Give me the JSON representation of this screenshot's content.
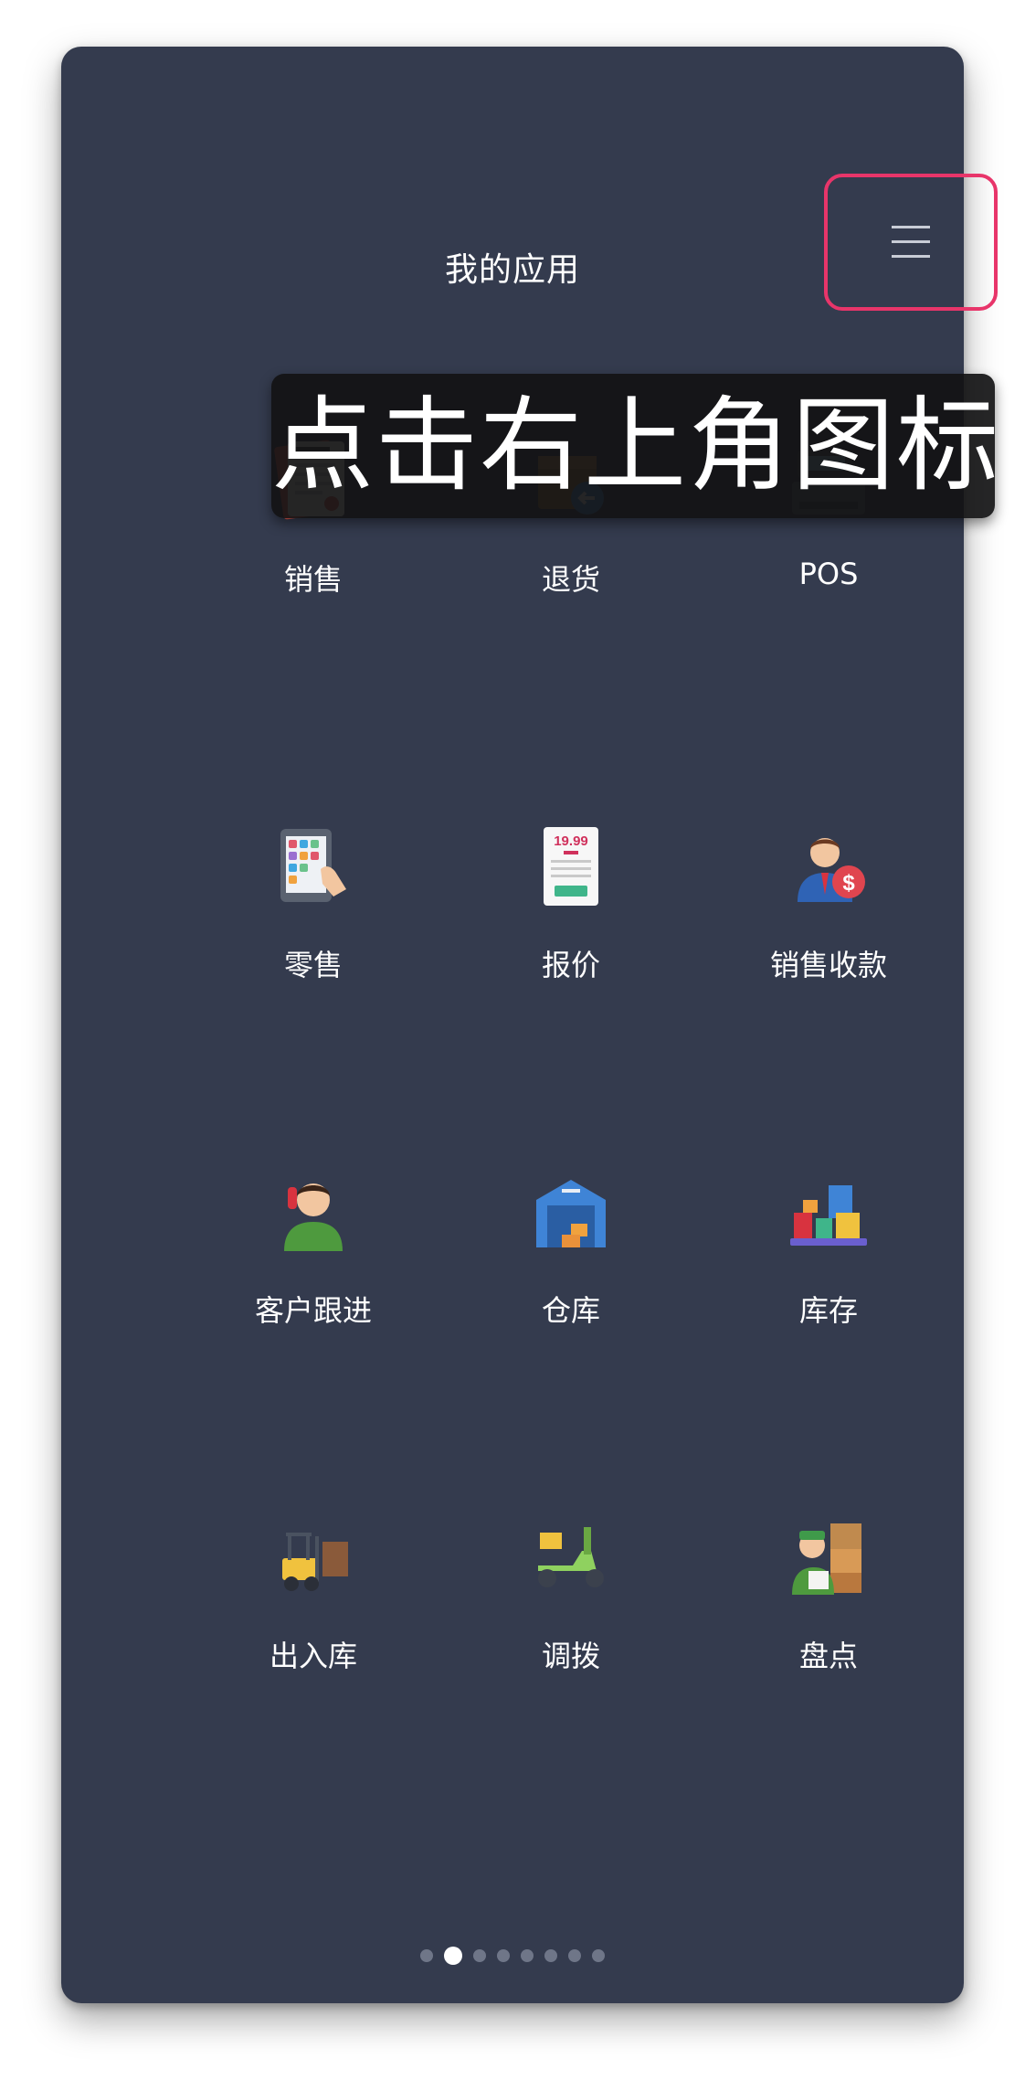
{
  "header": {
    "title": "我的应用"
  },
  "menu": {
    "icon": "hamburger-menu-icon"
  },
  "tooltip": {
    "text": "点击右上角图标"
  },
  "apps": [
    {
      "label": "销售",
      "icon": "order-form-icon"
    },
    {
      "label": "退货",
      "icon": "return-box-icon"
    },
    {
      "label": "POS",
      "icon": "cash-register-icon"
    },
    {
      "label": "零售",
      "icon": "tablet-keypad-icon"
    },
    {
      "label": "报价",
      "icon": "price-tag-receipt-icon"
    },
    {
      "label": "销售收款",
      "icon": "salesman-dollar-icon"
    },
    {
      "label": "客户跟进",
      "icon": "customer-phone-icon"
    },
    {
      "label": "仓库",
      "icon": "warehouse-icon"
    },
    {
      "label": "库存",
      "icon": "stock-boxes-icon"
    },
    {
      "label": "出入库",
      "icon": "forklift-icon"
    },
    {
      "label": "调拨",
      "icon": "delivery-scooter-icon"
    },
    {
      "label": "盘点",
      "icon": "inventory-worker-icon"
    }
  ],
  "pagination": {
    "pages": 8,
    "active_index": 1
  },
  "colors": {
    "background": "#343b4e",
    "highlight": "#e8356a"
  }
}
